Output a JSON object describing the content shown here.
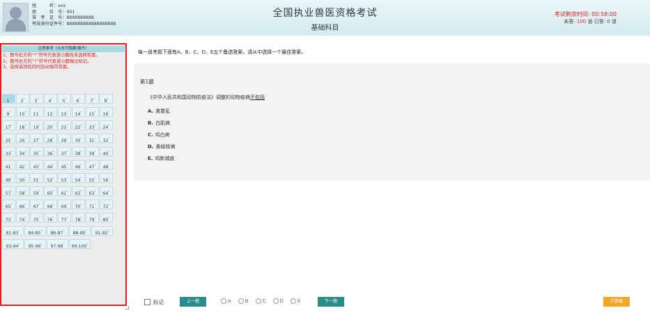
{
  "header": {
    "title": "全国执业兽医资格考试",
    "subtitle": "基础科目",
    "info": [
      "姓　　　名：xxx",
      "座　　　位　号：001",
      "准　考　证　号：8888888888",
      "有效身份证件号：888888888888888888"
    ],
    "timer": "考试剩余时间: 00:58:00",
    "counts": {
      "unanswered_label": "未答:",
      "unanswered": "100",
      "unit1": "道 已答:",
      "answered": "0",
      "unit2": "道"
    }
  },
  "notice": {
    "title": "注意事项（点击可隐藏/展开）",
    "items": [
      "1、题号右方的“*”符号代表该小题尚未选择答案。",
      "2、题号右方的“?”符号代表该小题做过标记。",
      "3、选择选项后同时自动保存答案。"
    ]
  },
  "question_numbers": [
    "1",
    "2",
    "3",
    "4",
    "5",
    "6",
    "7",
    "8",
    "9",
    "10",
    "11",
    "12",
    "13",
    "14",
    "15",
    "16",
    "17",
    "18",
    "19",
    "20",
    "21",
    "22",
    "23",
    "24",
    "25",
    "26",
    "27",
    "28",
    "29",
    "30",
    "31",
    "32",
    "33",
    "34",
    "35",
    "36",
    "37",
    "38",
    "39",
    "40",
    "41",
    "42",
    "43",
    "44",
    "45",
    "46",
    "47",
    "48",
    "49",
    "50",
    "51",
    "52",
    "53",
    "54",
    "55",
    "56",
    "57",
    "58",
    "59",
    "60",
    "61",
    "62",
    "63",
    "64",
    "65",
    "66",
    "67",
    "68",
    "69",
    "70",
    "71",
    "72",
    "73",
    "74",
    "75",
    "76",
    "77",
    "78",
    "79",
    "80"
  ],
  "question_groups": [
    "81-83",
    "84-85",
    "86-87",
    "88-90",
    "91-92",
    "93-94",
    "95-96",
    "97-98",
    "99-100"
  ],
  "unanswered_marker": "*",
  "main": {
    "instruction": "每一道考题下面有A、B、C、D、E五个备选答案，请从中选择一个最佳答案。",
    "question_number": "第1题",
    "stem": "《中华人民共和国动物防疫法》调整的动物疫病",
    "stem_emphasis": "不包括",
    "options": [
      {
        "letter": "A.",
        "text": "禽霍乱"
      },
      {
        "letter": "B.",
        "text": "白肌病"
      },
      {
        "letter": "C.",
        "text": "鸡白痢"
      },
      {
        "letter": "D.",
        "text": "禽结核病"
      },
      {
        "letter": "E.",
        "text": "鸡新城疫"
      }
    ]
  },
  "footer": {
    "mark_label": "标记",
    "prev_label": "上一题",
    "next_label": "下一题",
    "calc_label": "计算器",
    "radio_options": [
      "A",
      "B",
      "C",
      "D",
      "E"
    ]
  },
  "colors": {
    "accent": "#2a8c88",
    "alert": "#e02020",
    "calc": "#f5a623"
  }
}
